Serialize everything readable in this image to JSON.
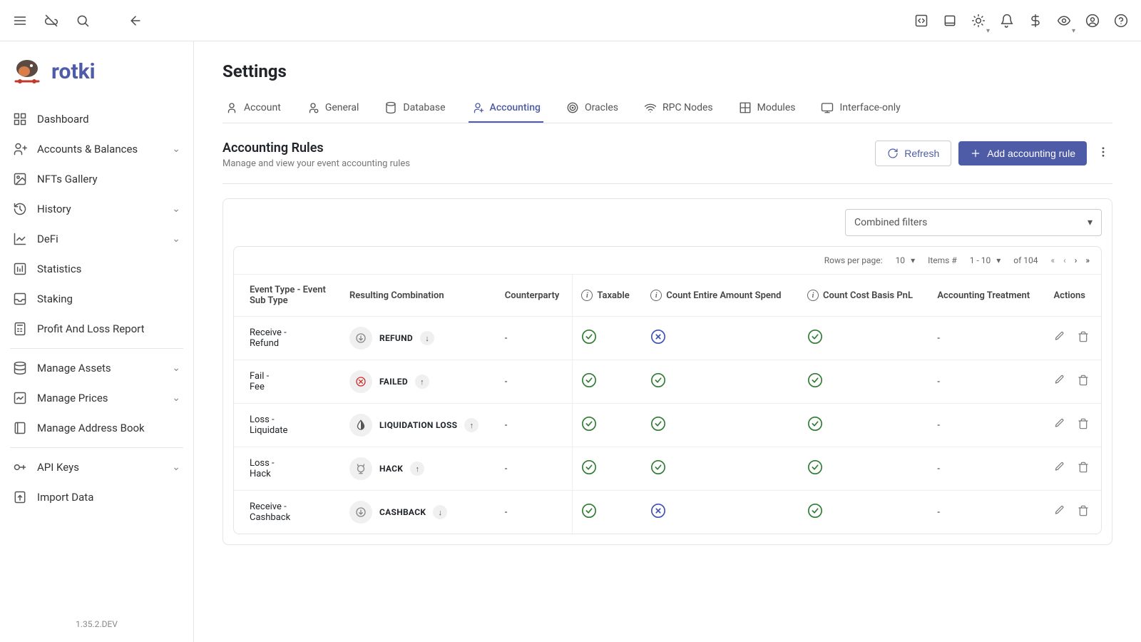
{
  "app_name": "rotki",
  "version": "1.35.2.DEV",
  "page_title": "Settings",
  "tabs": [
    {
      "label": "Account"
    },
    {
      "label": "General"
    },
    {
      "label": "Database"
    },
    {
      "label": "Accounting"
    },
    {
      "label": "Oracles"
    },
    {
      "label": "RPC Nodes"
    },
    {
      "label": "Modules"
    },
    {
      "label": "Interface-only"
    }
  ],
  "sidebar": [
    {
      "label": "Dashboard",
      "icon": "grid"
    },
    {
      "label": "Accounts & Balances",
      "icon": "users",
      "expandable": true
    },
    {
      "label": "NFTs Gallery",
      "icon": "image"
    },
    {
      "label": "History",
      "icon": "history",
      "expandable": true
    },
    {
      "label": "DeFi",
      "icon": "chart",
      "expandable": true
    },
    {
      "label": "Statistics",
      "icon": "bar"
    },
    {
      "label": "Staking",
      "icon": "inbox"
    },
    {
      "label": "Profit And Loss Report",
      "icon": "calc"
    },
    {
      "divider": true
    },
    {
      "label": "Manage Assets",
      "icon": "db",
      "expandable": true
    },
    {
      "label": "Manage Prices",
      "icon": "prices",
      "expandable": true
    },
    {
      "label": "Manage Address Book",
      "icon": "book"
    },
    {
      "divider": true
    },
    {
      "label": "API Keys",
      "icon": "key",
      "expandable": true
    },
    {
      "label": "Import Data",
      "icon": "import"
    }
  ],
  "section": {
    "title": "Accounting Rules",
    "desc": "Manage and view your event accounting rules",
    "refresh": "Refresh",
    "add": "Add accounting rule"
  },
  "filter": {
    "label": "Combined filters"
  },
  "pagination": {
    "rows_label": "Rows per page:",
    "rows_value": "10",
    "items_label": "Items #",
    "range": "1 - 10",
    "of": "of 104"
  },
  "columns": {
    "event_type": "Event Type - Event Sub Type",
    "combo": "Resulting Combination",
    "counterparty": "Counterparty",
    "taxable": "Taxable",
    "entire": "Count Entire Amount Spend",
    "cost_basis": "Count Cost Basis PnL",
    "treatment": "Accounting Treatment",
    "actions": "Actions"
  },
  "rows": [
    {
      "type": "Receive - Refund",
      "combo": "REFUND",
      "arrow": "down",
      "icon": "refund",
      "cp": "-",
      "taxable": "check",
      "entire": "cross",
      "cost": "check",
      "treat": "-"
    },
    {
      "type": "Fail - Fee",
      "combo": "FAILED",
      "arrow": "up",
      "icon": "fail",
      "cp": "-",
      "taxable": "check",
      "entire": "check",
      "cost": "check",
      "treat": "-"
    },
    {
      "type": "Loss - Liquidate",
      "combo": "LIQUIDATION LOSS",
      "arrow": "up",
      "icon": "liquid",
      "cp": "-",
      "taxable": "check",
      "entire": "check",
      "cost": "check",
      "treat": "-"
    },
    {
      "type": "Loss - Hack",
      "combo": "HACK",
      "arrow": "up",
      "icon": "hack",
      "cp": "-",
      "taxable": "check",
      "entire": "check",
      "cost": "check",
      "treat": "-"
    },
    {
      "type": "Receive - Cashback",
      "combo": "CASHBACK",
      "arrow": "down",
      "icon": "cashback",
      "cp": "-",
      "taxable": "check",
      "entire": "cross",
      "cost": "check",
      "treat": "-"
    }
  ]
}
